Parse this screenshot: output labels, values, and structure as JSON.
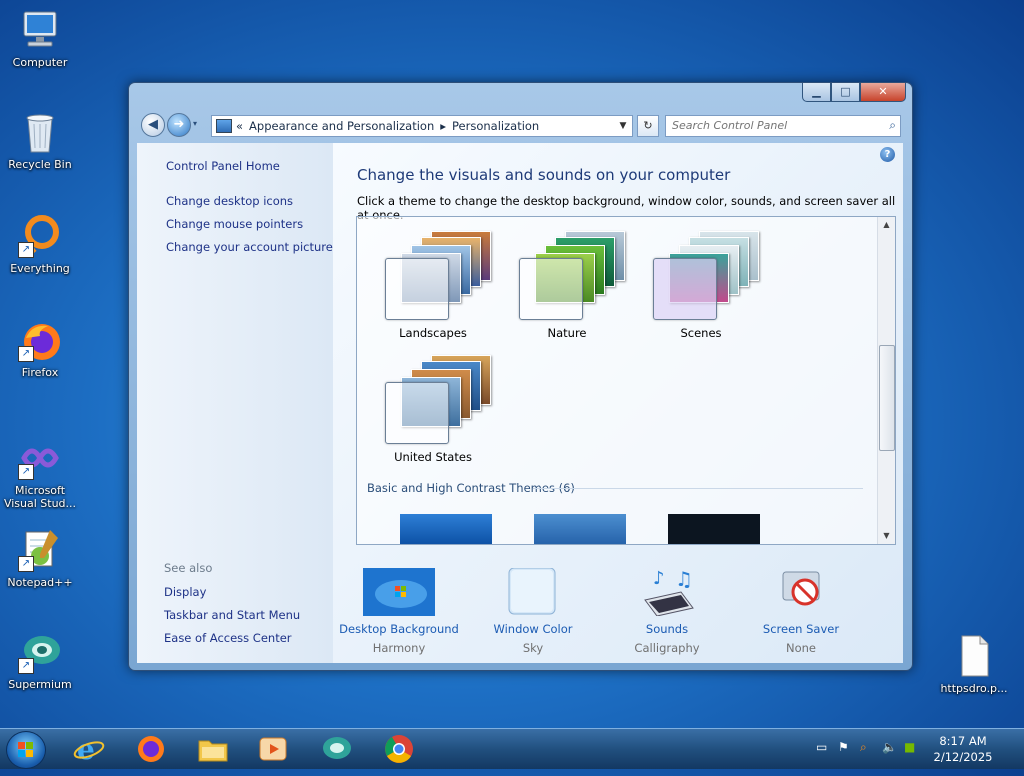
{
  "desktop": {
    "icons": [
      {
        "label": "Computer"
      },
      {
        "label": "Recycle Bin"
      },
      {
        "label": "Everything"
      },
      {
        "label": "Firefox"
      },
      {
        "label": "Microsoft Visual Stud..."
      },
      {
        "label": "Notepad++"
      },
      {
        "label": "Supermium"
      },
      {
        "label": "httpsdro.p..."
      }
    ]
  },
  "window": {
    "breadcrumb": {
      "prefix": "«",
      "items": [
        "Appearance and Personalization",
        "Personalization"
      ],
      "separator": "▸"
    },
    "search": {
      "placeholder": "Search Control Panel"
    },
    "left_pane": {
      "links": [
        "Control Panel Home",
        "Change desktop icons",
        "Change mouse pointers",
        "Change your account picture"
      ],
      "see_also_label": "See also",
      "see_also": [
        "Display",
        "Taskbar and Start Menu",
        "Ease of Access Center"
      ]
    },
    "main": {
      "title": "Change the visuals and sounds on your computer",
      "subtitle": "Click a theme to change the desktop background, window color, sounds, and screen saver all at once.",
      "themes": [
        {
          "label": "Landscapes"
        },
        {
          "label": "Nature"
        },
        {
          "label": "Scenes"
        },
        {
          "label": "United States"
        }
      ],
      "basic_section": "Basic and High Contrast Themes (6)",
      "bottom": [
        {
          "label": "Desktop Background",
          "value": "Harmony",
          "icon": "desktop-background-icon"
        },
        {
          "label": "Window Color",
          "value": "Sky",
          "icon": "window-color-icon"
        },
        {
          "label": "Sounds",
          "value": "Calligraphy",
          "icon": "sounds-icon"
        },
        {
          "label": "Screen Saver",
          "value": "None",
          "icon": "screen-saver-icon"
        }
      ]
    }
  },
  "taskbar": {
    "apps": [
      "internet-explorer-icon",
      "firefox-icon",
      "file-explorer-icon",
      "media-player-icon",
      "supermium-icon",
      "chrome-icon"
    ],
    "clock": {
      "time": "8:17 AM",
      "date": "2/12/2025"
    }
  }
}
